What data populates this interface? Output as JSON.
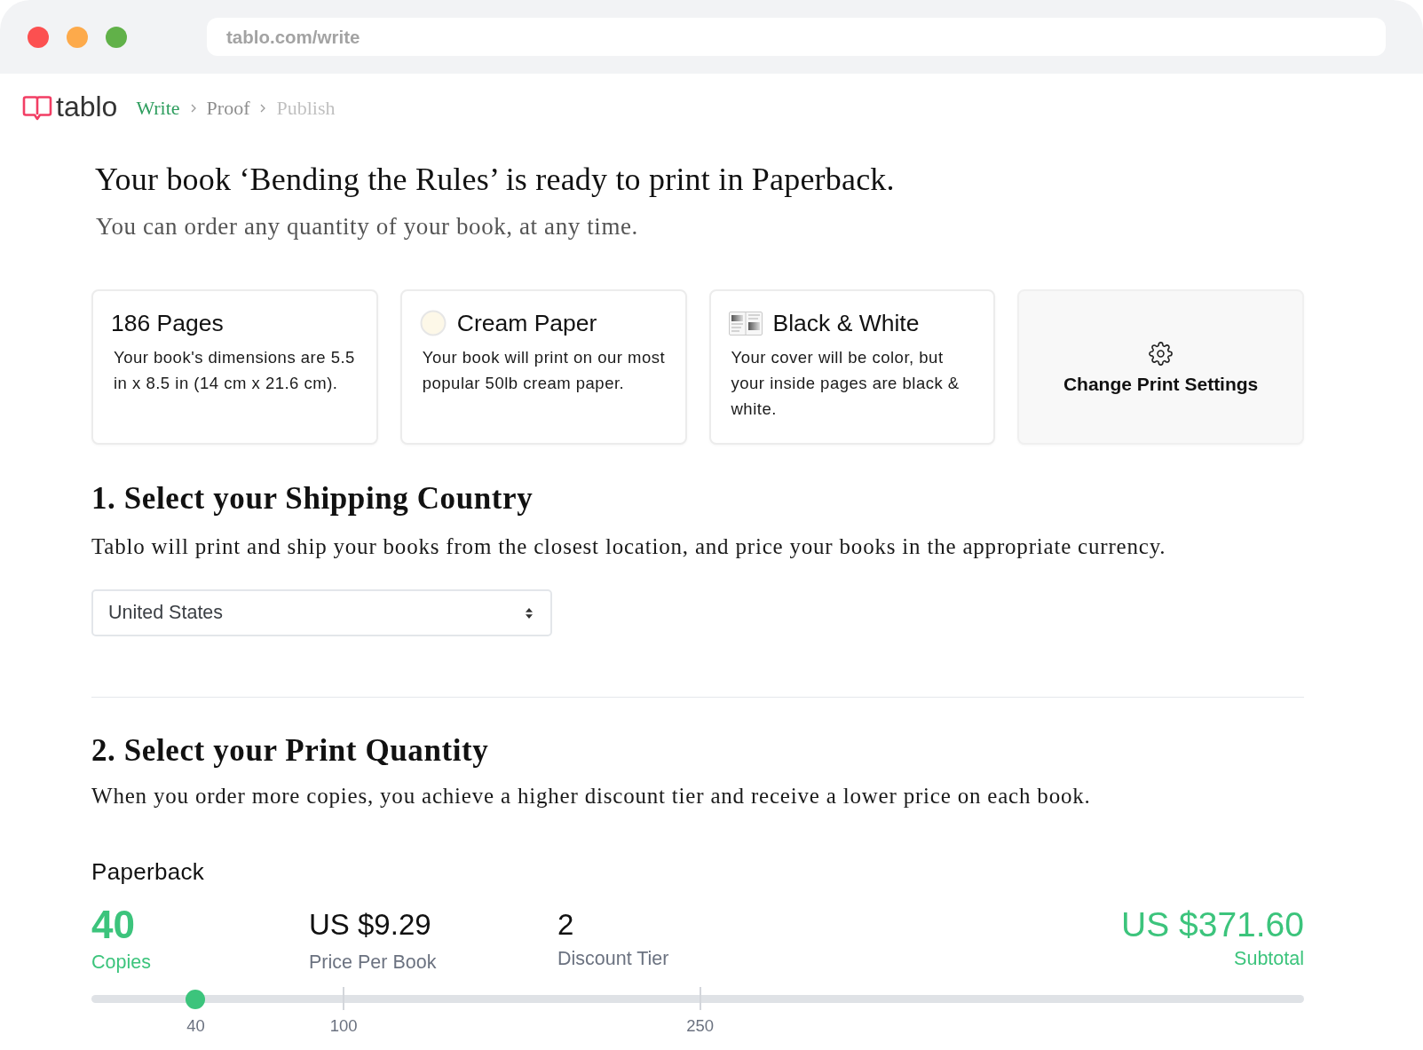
{
  "browser": {
    "url": "tablo.com/write"
  },
  "header": {
    "logo_text": "tablo",
    "breadcrumbs": [
      {
        "label": "Write",
        "selected": true,
        "disabled": false
      },
      {
        "label": "Proof",
        "selected": false,
        "disabled": false
      },
      {
        "label": "Publish",
        "selected": false,
        "disabled": true
      }
    ]
  },
  "intro": {
    "title": "Your book ‘Bending the Rules’ is ready to print in Paperback.",
    "subtitle": "You can order any quantity of your book, at any time."
  },
  "print_cards": [
    {
      "kind": "info",
      "title": "186 Pages",
      "text": "Your book's dimensions are 5.5 in x 8.5 in (14 cm x 21.6 cm)."
    },
    {
      "kind": "paper",
      "title": "Cream Paper",
      "text": "Your book will print on our most popular 50lb cream paper."
    },
    {
      "kind": "interior",
      "title": "Black & White",
      "text": "Your cover will be color, but your inside pages are black & white."
    },
    {
      "kind": "action",
      "title": "Change Print Settings"
    }
  ],
  "shipping": {
    "heading": "1. Select your Shipping Country",
    "description": "Tablo will print and ship your books from the closest location, and price your books in the appropriate currency.",
    "country_select": {
      "value": "United States"
    }
  },
  "quantity": {
    "heading": "2. Select your Print Quantity",
    "description": "When you order more copies, you achieve a higher discount tier and receive a lower price on each book.",
    "format": "Paperback",
    "stats": [
      {
        "kind": "copies",
        "value": "40",
        "label": "Copies"
      },
      {
        "kind": "price",
        "value": "US $9.29",
        "label": "Price Per Book"
      },
      {
        "kind": "tier",
        "value": "2",
        "label": "Discount Tier"
      },
      {
        "kind": "subtotal",
        "value": "US $371.60",
        "label": "Subtotal"
      }
    ],
    "slider": {
      "level": 0.086,
      "value_label": "40",
      "ticks": [
        {
          "label": "100",
          "level": 0.208
        },
        {
          "label": "250",
          "level": 0.502
        }
      ]
    }
  }
}
